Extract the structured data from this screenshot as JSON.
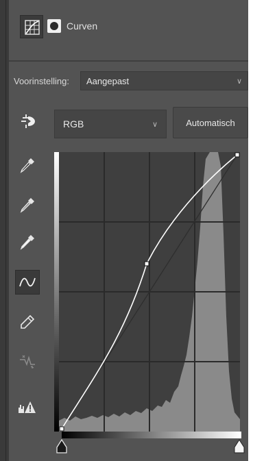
{
  "panel": {
    "title": "Curven",
    "adjustment_icon": "curves-layer-icon",
    "mask_icon": "layer-mask-icon"
  },
  "preset": {
    "label": "Voorinstelling:",
    "value": "Aangepast"
  },
  "channel": {
    "value": "RGB"
  },
  "auto_button": {
    "label": "Automatisch"
  },
  "tools": [
    {
      "name": "target-adjustment-icon",
      "active": false
    },
    {
      "name": "black-point-eyedropper-icon",
      "active": false
    },
    {
      "name": "gray-point-eyedropper-icon",
      "active": false
    },
    {
      "name": "white-point-eyedropper-icon",
      "active": false
    },
    {
      "name": "curve-points-icon",
      "active": true
    },
    {
      "name": "pencil-icon",
      "active": false
    },
    {
      "name": "smooth-curve-icon",
      "active": false
    },
    {
      "name": "clipping-warning-icon",
      "active": false
    }
  ],
  "curve": {
    "points": [
      [
        0,
        0
      ],
      [
        0.46,
        0.6
      ],
      [
        1,
        1
      ]
    ],
    "grid_divisions": 4
  },
  "colors": {
    "panel_bg": "#535353",
    "graph_bg": "#3f3f3f",
    "histogram": "#8a8a8a",
    "grid": "#2a2a2a",
    "curve": "#ffffff"
  }
}
